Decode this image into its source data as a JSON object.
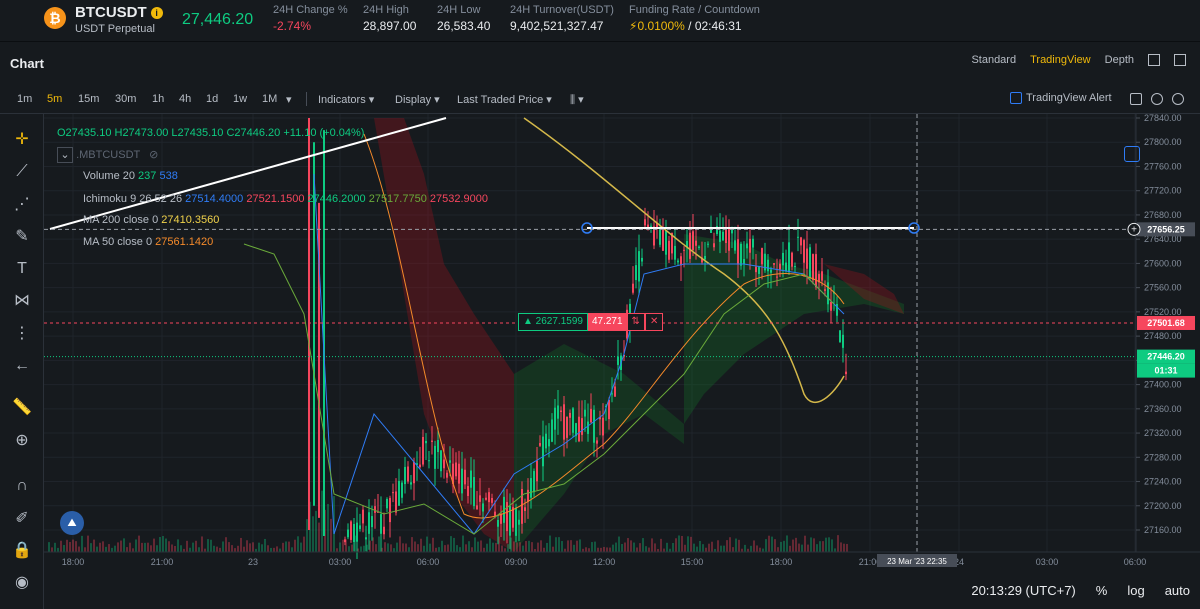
{
  "ticker": {
    "symbol": "BTCUSDT",
    "subtitle": "USDT Perpetual",
    "last_price": "27,446.20",
    "change_label": "24H Change %",
    "change_value": "-2.74%",
    "high_label": "24H High",
    "high_value": "28,897.00",
    "low_label": "24H Low",
    "low_value": "26,583.40",
    "turnover_label": "24H Turnover(USDT)",
    "turnover_value": "9,402,521,327.47",
    "funding_label": "Funding Rate / Countdown",
    "funding_rate": "0.0100%",
    "countdown": "02:46:31"
  },
  "header": {
    "title": "Chart",
    "tabs": [
      "Standard",
      "TradingView",
      "Depth"
    ],
    "active_tab": "TradingView"
  },
  "toolbar": {
    "timeframes": [
      "1m",
      "5m",
      "15m",
      "30m",
      "1h",
      "4h",
      "1d",
      "1w",
      "1M"
    ],
    "active_timeframe": "5m",
    "indicators": "Indicators",
    "display": "Display",
    "price_type": "Last Traded Price",
    "tv_alert": "TradingView Alert"
  },
  "legend": {
    "ohlc": {
      "o": "O27435.10",
      "h": "H27473.00",
      "l": "L27435.10",
      "c": "C27446.20",
      "chg": "+11.10 (+0.04%)"
    },
    "symbol": ".MBTCUSDT",
    "volume_label": "Volume 20",
    "volume_v1": "237",
    "volume_v2": "538",
    "ichimoku_label": "Ichimoku 9 26 52 26",
    "ichimoku_values": [
      "27514.4000",
      "27521.1500",
      "27446.2000",
      "27517.7750",
      "27532.9000"
    ],
    "ma200_label": "MA 200 close 0",
    "ma200_value": "27410.3560",
    "ma50_label": "MA 50 close 0",
    "ma50_value": "27561.1420"
  },
  "price_axis": {
    "ticks": [
      "27840.00",
      "27800.00",
      "27760.00",
      "27720.00",
      "27680.00",
      "27640.00",
      "27600.00",
      "27560.00",
      "27520.00",
      "27480.00",
      "27440.00",
      "27400.00",
      "27360.00",
      "27320.00",
      "27280.00",
      "27240.00",
      "27200.00",
      "27160.00"
    ],
    "crosshair_price": "27656.25",
    "red_line_price": "27501.68",
    "last_price": "27446.20",
    "countdown": "01:31"
  },
  "time_axis": {
    "labels": [
      "18:00",
      "21:00",
      "23",
      "03:00",
      "06:00",
      "09:00",
      "12:00",
      "15:00",
      "18:00",
      "21:00",
      "24",
      "03:00",
      "06:00"
    ],
    "crosshair_time": "23 Mar '23   22:35"
  },
  "measure": {
    "price_diff": "▲ 2627.1599",
    "value": "47.271"
  },
  "footer": {
    "clock": "20:13:29 (UTC+7)",
    "percent": "%",
    "log": "log",
    "auto": "auto"
  },
  "colors": {
    "up": "#0ecb81",
    "down": "#f6465d",
    "accent": "#f0b90b"
  }
}
